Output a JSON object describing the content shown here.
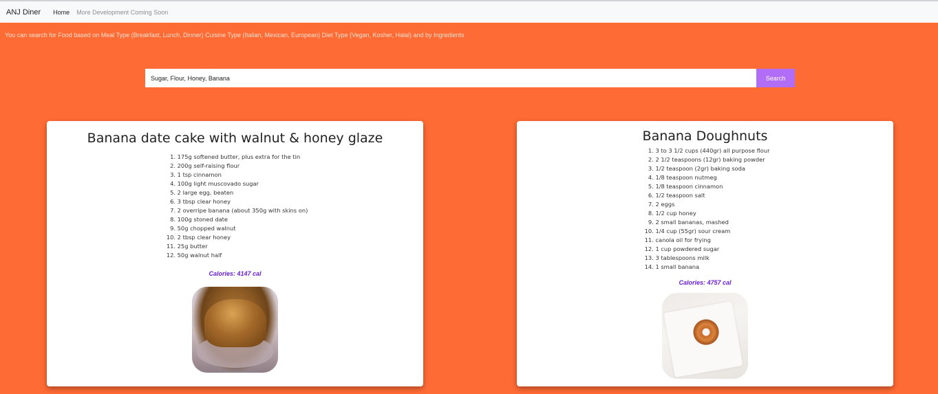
{
  "navbar": {
    "brand": "ANJ Diner",
    "links": [
      "Home",
      "More Development Coming Soon"
    ]
  },
  "hint": "You can search for Food based on Meal Type (Breakfast, Lunch, Dinner) Cuisine Type (Italian, Mexican, European) Diet Type (Vegan, Kosher, Halal) and by Ingredients",
  "search": {
    "value": "Sugar, Flour, Honey, Banana",
    "button_label": "Search"
  },
  "colors": {
    "page_background": "#ff6b35",
    "search_button": "#b26df7",
    "calories_text": "#6a1ed8"
  },
  "recipes": [
    {
      "title": "Banana date cake with walnut & honey glaze",
      "ingredients": [
        "175g softened butter, plus extra for the tin",
        "200g self-raising flour",
        "1 tsp cinnamon",
        "100g light muscovado sugar",
        "2 large egg, beaten",
        "3 tbsp clear honey",
        "2 overripe banana (about 350g with skins on)",
        "100g stoned date",
        "50g chopped walnut",
        "2 tbsp clear honey",
        "25g butter",
        "50g walnut half"
      ],
      "calories": "Calories: 4147 cal",
      "image": "banana-date-cake-photo"
    },
    {
      "title": "Banana Doughnuts",
      "ingredients": [
        "3 to 3 1/2 cups (440gr) all purpose flour",
        "2 1/2 teaspoons (12gr) baking powder",
        "1/2 teaspoon (2gr) baking soda",
        "1/8 teaspoon nutmeg",
        "1/8 teaspoon cinnamon",
        "1/2 teaspoon salt",
        "2 eggs",
        "1/2 cup honey",
        "2 small bananas, mashed",
        "1/4 cup (55gr) sour cream",
        "canola oil for frying",
        "1 cup powdered sugar",
        "3 tablespoons milk",
        "1 small banana"
      ],
      "calories": "Calories: 4757 cal",
      "image": "banana-doughnut-photo"
    }
  ]
}
